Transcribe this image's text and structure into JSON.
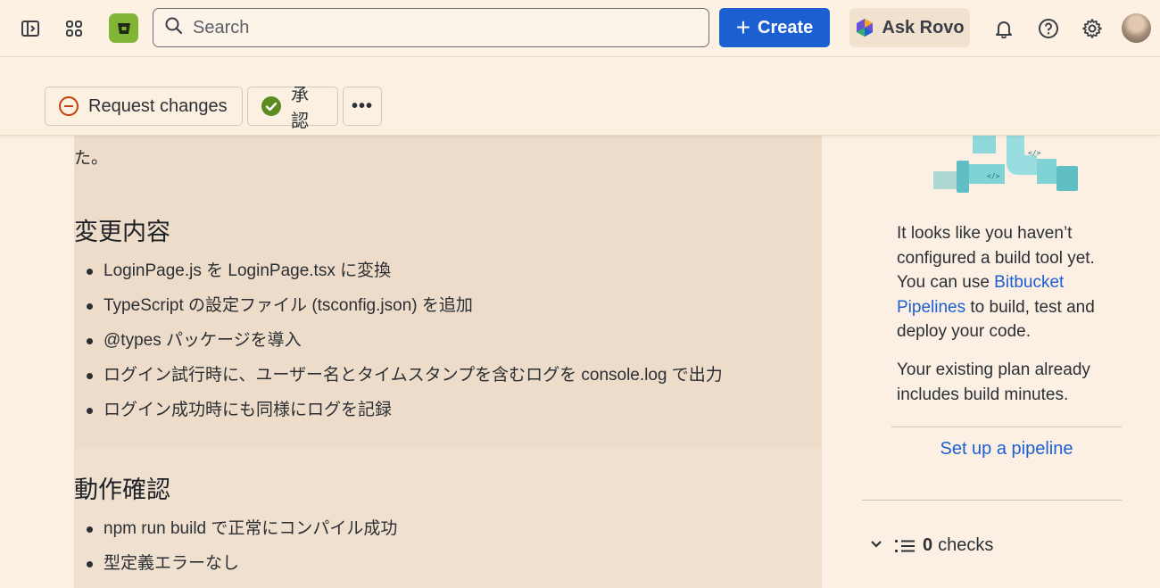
{
  "topbar": {
    "search_placeholder": "Search",
    "create_label": "Create",
    "ask_rovo_label": "Ask Rovo",
    "icons": [
      "sidebar-toggle-icon",
      "app-switcher-icon",
      "bitbucket-logo-icon",
      "search-icon",
      "notifications-bell-icon",
      "help-icon",
      "settings-gear-icon"
    ]
  },
  "actions": {
    "request_changes_label": "Request changes",
    "approve_label": "承認",
    "more_label": "•••"
  },
  "description": {
    "trailing_text": "た。",
    "sections": [
      {
        "heading": "変更内容",
        "items": [
          "LoginPage.js を LoginPage.tsx に変換",
          "TypeScript の設定ファイル (tsconfig.json) を追加",
          "@types パッケージを導入",
          "ログイン試行時に、ユーザー名とタイムスタンプを含むログを console.log で出力",
          "ログイン成功時にも同様にログを記録"
        ]
      },
      {
        "heading": "動作確認",
        "items": [
          "npm run build で正常にコンパイル成功",
          "型定義エラーなし"
        ]
      }
    ]
  },
  "pipeline_panel": {
    "line1": "It looks like you haven’t configured a build tool yet. You can use ",
    "link": "Bitbucket Pipelines",
    "line1_end": " to build, test and deploy your code.",
    "line2": "Your existing plan already includes build minutes.",
    "setup_link": "Set up a pipeline"
  },
  "checks": {
    "count": "0",
    "label": "checks"
  },
  "colors": {
    "primary": "#1c5fd1",
    "logo_green": "#82b536",
    "approve_green": "#5b8a1f",
    "request_changes_orange": "#c2410c"
  }
}
